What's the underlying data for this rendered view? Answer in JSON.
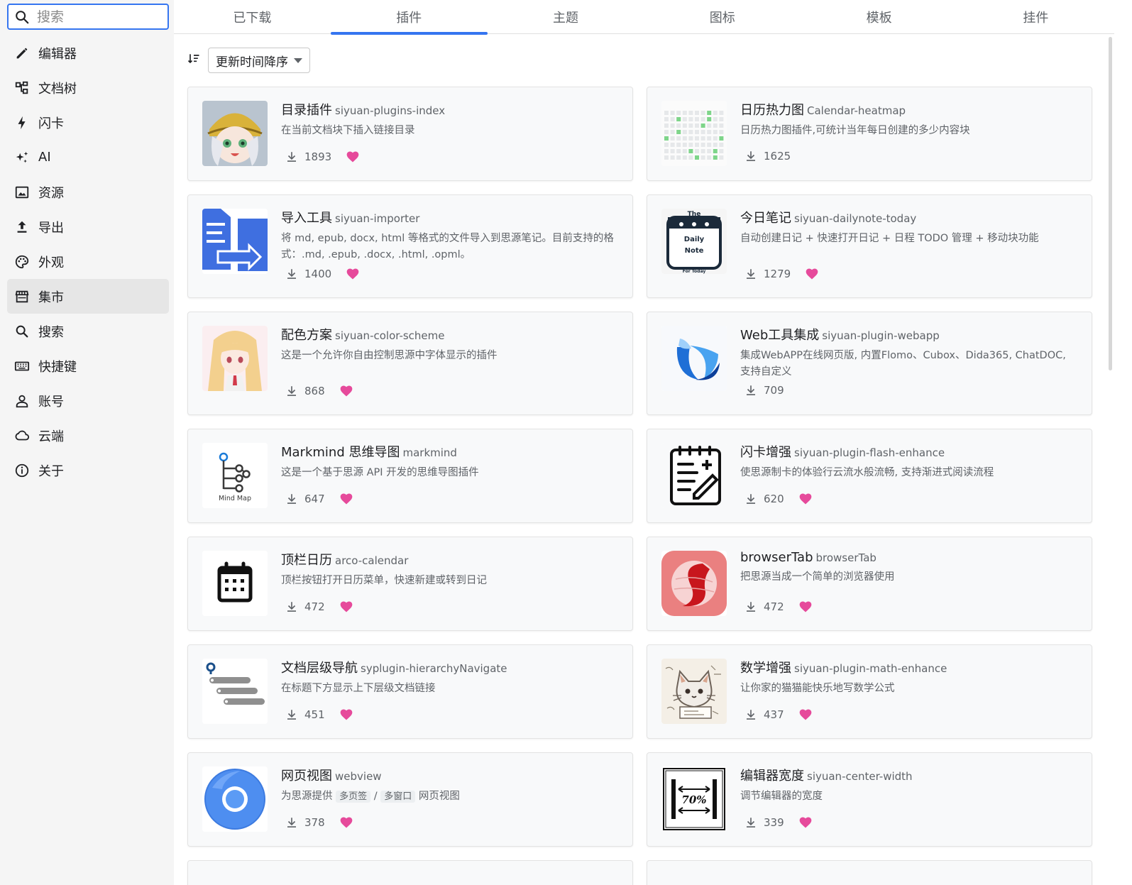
{
  "sidebar": {
    "search_placeholder": "搜索",
    "items": [
      {
        "label": "编辑器",
        "icon": "pencil-icon",
        "active": false
      },
      {
        "label": "文档树",
        "icon": "tree-icon",
        "active": false
      },
      {
        "label": "闪卡",
        "icon": "lightning-icon",
        "active": false
      },
      {
        "label": "AI",
        "icon": "sparkle-icon",
        "active": false
      },
      {
        "label": "资源",
        "icon": "image-icon",
        "active": false
      },
      {
        "label": "导出",
        "icon": "upload-icon",
        "active": false
      },
      {
        "label": "外观",
        "icon": "palette-icon",
        "active": false
      },
      {
        "label": "集市",
        "icon": "store-icon",
        "active": true
      },
      {
        "label": "搜索",
        "icon": "search-icon",
        "active": false
      },
      {
        "label": "快捷键",
        "icon": "keyboard-icon",
        "active": false
      },
      {
        "label": "账号",
        "icon": "account-icon",
        "active": false
      },
      {
        "label": "云端",
        "icon": "cloud-icon",
        "active": false
      },
      {
        "label": "关于",
        "icon": "info-icon",
        "active": false
      }
    ]
  },
  "tabs": [
    {
      "label": "已下载",
      "active": false
    },
    {
      "label": "插件",
      "active": true
    },
    {
      "label": "主题",
      "active": false
    },
    {
      "label": "图标",
      "active": false
    },
    {
      "label": "模板",
      "active": false
    },
    {
      "label": "挂件",
      "active": false
    }
  ],
  "toolbar": {
    "sort_label": "更新时间降序"
  },
  "colors": {
    "accent": "#3575f0",
    "heart": "#e64a9b"
  },
  "plugins": [
    {
      "name": "目录插件",
      "package": "siyuan-plugins-index",
      "description": "在当前文档块下插入链接目录",
      "downloads": "1893",
      "thumb": "anime-girl-yellow-hat"
    },
    {
      "name": "日历热力图",
      "package": "Calendar-heatmap",
      "description": "日历热力图插件,可统计当年每日创建的多少内容块",
      "downloads": "1625",
      "thumb": "heatmap-grid"
    },
    {
      "name": "导入工具",
      "package": "siyuan-importer",
      "description": "将 md, epub, docx, html 等格式的文件导入到思源笔记。目前支持的格式：.md, .epub, .docx, .html, .opml。",
      "downloads": "1400",
      "thumb": "import-arrow"
    },
    {
      "name": "今日笔记",
      "package": "siyuan-dailynote-today",
      "description": "自动创建日记 + 快速打开日记 + 日程 TODO 管理 + 移动块功能",
      "downloads": "1279",
      "thumb": "daily-note-logo"
    },
    {
      "name": "配色方案",
      "package": "siyuan-color-scheme",
      "description": "这是一个允许你自由控制思源中字体显示的插件",
      "downloads": "868",
      "thumb": "anime-girl-blonde"
    },
    {
      "name": "Web工具集成",
      "package": "siyuan-plugin-webapp",
      "description": "集成WebAPP在线网页版, 内置Flomo、Cubox、Dida365, ChatDOC, 支持自定义",
      "downloads": "709",
      "thumb": "blue-petal"
    },
    {
      "name": "Markmind 思维导图",
      "package": "markmind",
      "description": "这是一个基于思源 API 开发的思维导图插件",
      "downloads": "647",
      "thumb": "mind-map",
      "thumb_text": "Mind Map"
    },
    {
      "name": "闪卡增强",
      "package": "siyuan-plugin-flash-enhance",
      "description": "使思源制卡的体验行云流水般流畅, 支持渐进式阅读流程",
      "downloads": "620",
      "thumb": "notepad-edit"
    },
    {
      "name": "顶栏日历",
      "package": "arco-calendar",
      "description": "顶栏按钮打开日历菜单，快速新建或转到日记",
      "downloads": "472",
      "thumb": "calendar"
    },
    {
      "name": "browserTab",
      "package": "browserTab",
      "description": "把思源当成一个简单的浏览器使用",
      "downloads": "472",
      "thumb": "red-sphere"
    },
    {
      "name": "文档层级导航",
      "package": "syplugin-hierarchyNavigate",
      "description": "在标题下方显示上下层级文档链接",
      "downloads": "451",
      "thumb": "hierarchy-bars"
    },
    {
      "name": "数学增强",
      "package": "siyuan-plugin-math-enhance",
      "description": "让你家的猫猫能快乐地写数学公式",
      "downloads": "437",
      "thumb": "cat-math"
    },
    {
      "name": "网页视图",
      "package": "webview",
      "description": "为思源提供",
      "description_code_1": "多页签",
      "description_sep": "/",
      "description_code_2": "多窗口",
      "description_tail": "网页视图",
      "downloads": "378",
      "thumb": "chrome-circle"
    },
    {
      "name": "编辑器宽度",
      "package": "siyuan-center-width",
      "description": "调节编辑器的宽度",
      "downloads": "339",
      "thumb": "width-70",
      "thumb_text": "70%"
    }
  ]
}
